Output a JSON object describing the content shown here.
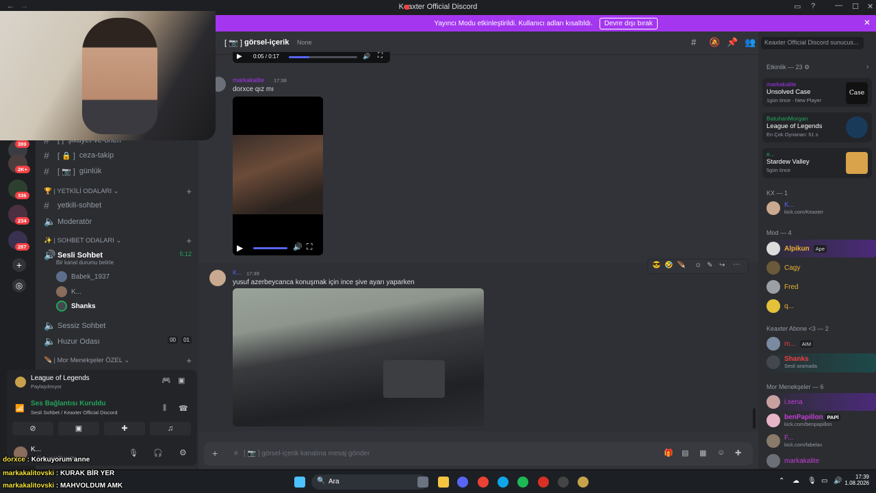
{
  "window": {
    "title": "Keaxter Official Discord"
  },
  "banner": {
    "text": "Yayıncı Modu etkinleştirildi. Kullanıcı adları kısaltıldı.",
    "button": "Devre dışı bırak"
  },
  "guilds": {
    "badges": [
      "399",
      "2K+",
      "336",
      "234",
      "287"
    ]
  },
  "sidebar": {
    "channels": [
      {
        "name": "şikayet-ve-öneri",
        "prefix": "[ ]"
      },
      {
        "name": "ceza-takip",
        "prefix": "[ 🔒 ]"
      },
      {
        "name": "günlük",
        "prefix": "[ 📷 ]"
      }
    ],
    "cat_yetkili": "YETKİLİ ODALARI",
    "yetkili_channels": [
      "yetkili-sohbet",
      "Moderatör"
    ],
    "cat_sohbet": "SOHBET ODALARI",
    "voice_channel": {
      "name": "Sesli Sohbet",
      "time": "5:12",
      "status": "Bir kanal durumu belirle"
    },
    "voice_users": [
      "Babek_1937",
      "K...",
      "Shanks"
    ],
    "other_voice": [
      "Sessiz Sohbet",
      "Huzur Odası"
    ],
    "huzur_counts": [
      "00",
      "01"
    ],
    "cat_mor": "Mor Menekşeler ÖZEL"
  },
  "activity_panel": {
    "game": "League of Legends",
    "sub": "Paylaşılmıyor"
  },
  "voice_panel": {
    "status": "Ses Bağlantısı Kuruldu",
    "sub": "Sesli Sohbet / Keaxter Official Discord"
  },
  "user_panel": {
    "name": "K...",
    "sub": "kick.com/Keaxter"
  },
  "overlay_chat": [
    {
      "user": "dorxce",
      "text": "Korkuyorum anne"
    },
    {
      "user": "markakalitovski",
      "text": "KURAK BİR YER"
    },
    {
      "user": "markakalitovski",
      "text": "MAHVOLDUM AMK"
    }
  ],
  "chat_header": {
    "channel": "görsel-içerik",
    "prefix": "[ 📷 ]",
    "topic": "None",
    "search_placeholder": "Keaxter Official Discord sunucus..."
  },
  "messages": [
    {
      "video_time": "0:05 / 0:17"
    },
    {
      "author": "markakalite",
      "time": "17:38",
      "text": "dorxce qız mı"
    },
    {
      "author": "K...",
      "time": "17:39",
      "text": "yusuf azerbeycanca konuşmak için ince şive ayarı yaparken"
    }
  ],
  "composer": {
    "placeholder": "[ 📷 ] görsel-içerik kanalına mesaj gönder"
  },
  "members": {
    "activity_header": "Etkinlik — 23",
    "activities": [
      {
        "user": "markakalite",
        "game": "Unsolved Case",
        "sub1": "1gün önce",
        "sub2": "New Player",
        "thumb_text": "Case"
      },
      {
        "user": "BatuhanMorgan",
        "game": "League of Legends",
        "sub1": "En Çok Oynanan: 51 s"
      },
      {
        "user": "e...",
        "game": "Stardew Valley",
        "sub1": "5gün önce"
      }
    ],
    "kx_header": "KX — 1",
    "kx_user": {
      "name": "K...",
      "sub": "kick.com/Keaxter"
    },
    "mod_header": "Mod — 4",
    "mods": [
      "Alpikun",
      "Cagy",
      "Fred",
      "q..."
    ],
    "alpikun_tag": "Ape",
    "abone_header": "Keaxter Abone <3 — 2",
    "abone": [
      {
        "name": "m...",
        "tag": "AIM"
      },
      {
        "name": "Shanks",
        "sub": "Sesli aramada"
      }
    ],
    "mor_header": "Mor Menekşeler — 6",
    "mor": [
      {
        "name": "i.sena"
      },
      {
        "name": "benPapillon",
        "tag": "PAPİ",
        "sub": "kick.com/benpapillon"
      },
      {
        "name": "F...",
        "sub": "kick.com/fabelav"
      },
      {
        "name": "markakalite"
      }
    ]
  },
  "taskbar": {
    "search": "Ara",
    "time": "17:39",
    "date": "1.08.2026"
  },
  "colors": {
    "accent": "#a436f0",
    "blurple": "#5865f2",
    "online": "#23a55a"
  }
}
